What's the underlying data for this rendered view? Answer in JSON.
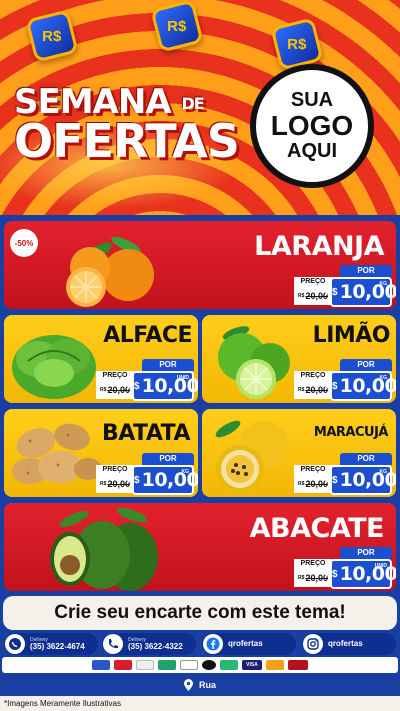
{
  "header": {
    "title_line1": "SEMANA",
    "title_de": "DE",
    "title_line2": "OFERTAS",
    "coin_symbol": "R$",
    "logo_line1": "SUA",
    "logo_line2": "LOGO",
    "logo_line3": "AQUI"
  },
  "products": [
    {
      "name": "LARANJA",
      "badge": "-50%",
      "preco_label": "PREÇO",
      "por_label": "POR",
      "old_price": "20,00",
      "currency": "R$",
      "price": "10,00",
      "unit": "KG",
      "icon": "orange-icon"
    },
    {
      "name": "ALFACE",
      "preco_label": "PREÇO",
      "por_label": "POR",
      "old_price": "20,00",
      "currency": "R$",
      "price": "10,00",
      "unit": "UNID",
      "icon": "lettuce-icon"
    },
    {
      "name": "LIMÃO",
      "preco_label": "PREÇO",
      "por_label": "POR",
      "old_price": "20,00",
      "currency": "R$",
      "price": "10,00",
      "unit": "KG",
      "icon": "lime-icon"
    },
    {
      "name": "BATATA",
      "preco_label": "PREÇO",
      "por_label": "POR",
      "old_price": "20,00",
      "currency": "R$",
      "price": "10,00",
      "unit": "KG",
      "icon": "potato-icon"
    },
    {
      "name": "MARACUJÁ",
      "preco_label": "PREÇO",
      "por_label": "POR",
      "old_price": "20,00",
      "currency": "R$",
      "price": "10,00",
      "unit": "KG",
      "icon": "passion-fruit-icon"
    },
    {
      "name": "ABACATE",
      "preco_label": "PREÇO",
      "por_label": "POR",
      "old_price": "20,00",
      "currency": "R$",
      "price": "10,00",
      "unit": "UNID",
      "icon": "avocado-icon"
    }
  ],
  "old_price_prefix": "R$",
  "cta": "Crie seu encarte com este tema!",
  "contacts": [
    {
      "icon": "whatsapp-icon",
      "label": "Delivery",
      "value": "(35) 3622-4674"
    },
    {
      "icon": "phone-icon",
      "label": "Delivery",
      "value": "(35) 3622-4322"
    },
    {
      "icon": "facebook-icon",
      "value": "qrofertas"
    },
    {
      "icon": "instagram-icon",
      "value": "qrofertas"
    }
  ],
  "payments": [
    "card-icon",
    "card-icon",
    "card-icon",
    "card-icon",
    "card-icon",
    "card-icon",
    "card-icon",
    "VISA",
    "mastercard-icon",
    "hipercard-icon"
  ],
  "address": {
    "icon": "location-pin-icon",
    "label": "Rua"
  },
  "disclaimer": "*Imagens Meramente Ilustrativas",
  "colors": {
    "red": "#e1222e",
    "yellow": "#ffce1a",
    "blue": "#1a3fa3",
    "price_blue": "#1b4fd0"
  }
}
